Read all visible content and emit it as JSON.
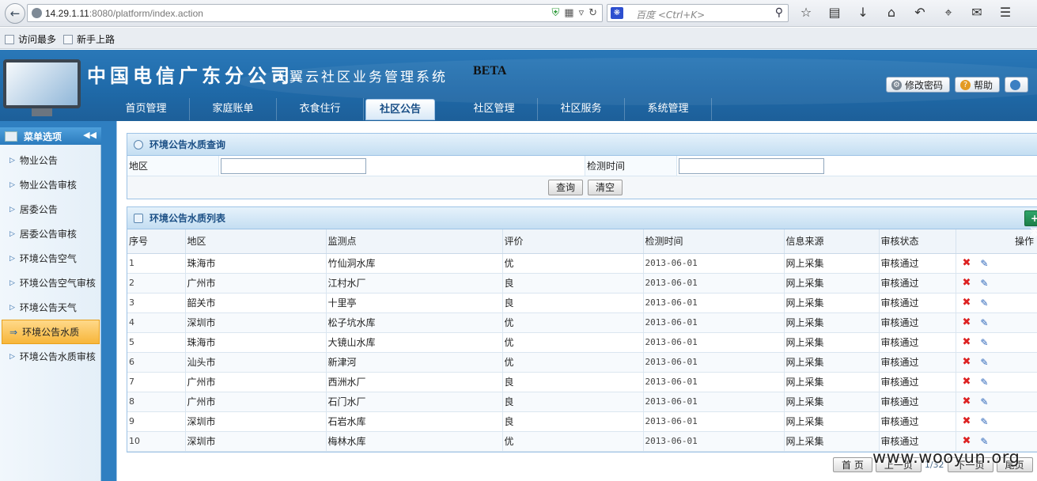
{
  "browser": {
    "url_host": "14.29.1.11",
    "url_rest": ":8080/platform/index.action",
    "search_engine_icon": "paw-icon",
    "search_placeholder": "百度 <Ctrl+K>",
    "bookmarks": [
      "访问最多",
      "新手上路"
    ]
  },
  "header": {
    "company": "中国电信广东分公司",
    "system_title": "天翼云社区业务管理系统",
    "beta": "BETA",
    "buttons": [
      "修改密码",
      "帮助"
    ]
  },
  "nav": {
    "items": [
      "首页管理",
      "家庭账单",
      "衣食住行",
      "社区公告",
      "社区管理",
      "社区服务",
      "系统管理"
    ],
    "active": "社区公告"
  },
  "sidebar": {
    "title": "菜单选项",
    "items": [
      "物业公告",
      "物业公告审核",
      "居委公告",
      "居委公告审核",
      "环境公告空气",
      "环境公告空气审核",
      "环境公告天气",
      "环境公告水质",
      "环境公告水质审核"
    ],
    "active": "环境公告水质"
  },
  "query": {
    "title": "环境公告水质查询",
    "label_region": "地区",
    "label_time": "检测时间",
    "region_value": "",
    "time_value": "",
    "btn_query": "查询",
    "btn_clear": "清空"
  },
  "list": {
    "title": "环境公告水质列表",
    "add_label": "+ 添",
    "columns": [
      "序号",
      "地区",
      "监测点",
      "评价",
      "检测时间",
      "信息来源",
      "审核状态",
      "操作"
    ],
    "rows": [
      [
        "1",
        "珠海市",
        "竹仙洞水库",
        "优",
        "2013-06-01",
        "网上采集",
        "审核通过"
      ],
      [
        "2",
        "广州市",
        "江村水厂",
        "良",
        "2013-06-01",
        "网上采集",
        "审核通过"
      ],
      [
        "3",
        "韶关市",
        "十里亭",
        "良",
        "2013-06-01",
        "网上采集",
        "审核通过"
      ],
      [
        "4",
        "深圳市",
        "松子坑水库",
        "优",
        "2013-06-01",
        "网上采集",
        "审核通过"
      ],
      [
        "5",
        "珠海市",
        "大镜山水库",
        "优",
        "2013-06-01",
        "网上采集",
        "审核通过"
      ],
      [
        "6",
        "汕头市",
        "新津河",
        "优",
        "2013-06-01",
        "网上采集",
        "审核通过"
      ],
      [
        "7",
        "广州市",
        "西洲水厂",
        "良",
        "2013-06-01",
        "网上采集",
        "审核通过"
      ],
      [
        "8",
        "广州市",
        "石门水厂",
        "良",
        "2013-06-01",
        "网上采集",
        "审核通过"
      ],
      [
        "9",
        "深圳市",
        "石岩水库",
        "良",
        "2013-06-01",
        "网上采集",
        "审核通过"
      ],
      [
        "10",
        "深圳市",
        "梅林水库",
        "优",
        "2013-06-01",
        "网上采集",
        "审核通过"
      ]
    ]
  },
  "pager": {
    "first": "首 页",
    "prev": "上一页",
    "info": "1/32",
    "next": "下一页",
    "last": "尾页"
  },
  "watermark": "www.wooyun.org"
}
